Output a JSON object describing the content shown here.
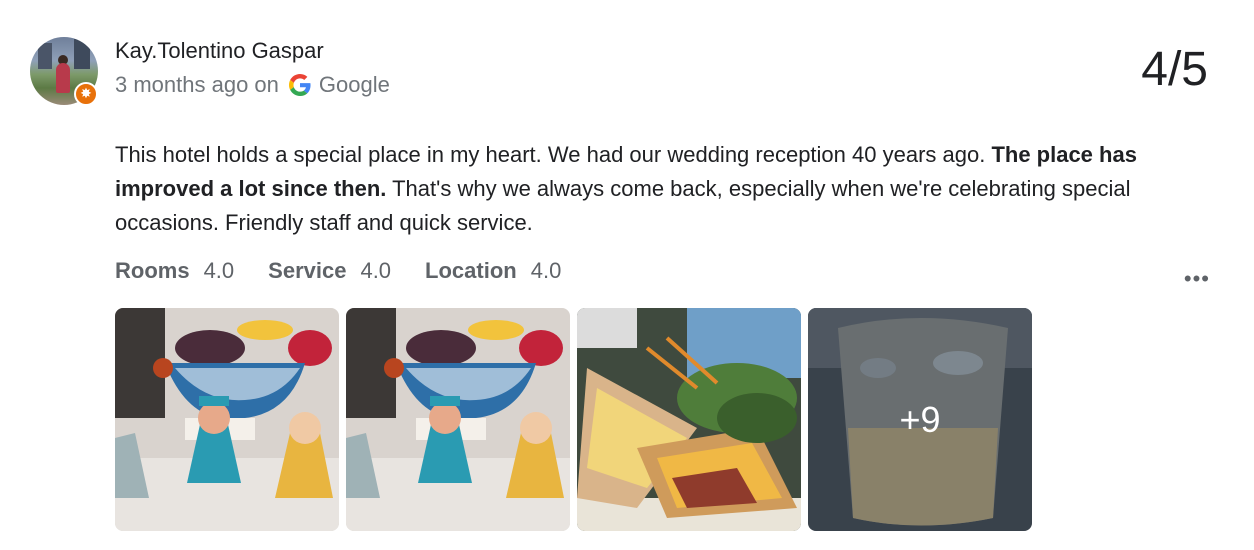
{
  "review": {
    "author": "Kay.Tolentino Gaspar",
    "time": "3 months ago on",
    "source": "Google",
    "rating": "4/5",
    "badge_icon": "local-guide-star-icon",
    "text_part1": "This hotel holds a special place in my heart. We had our wedding reception 40 years ago. ",
    "text_bold": "The place has improved a lot since then.",
    "text_part2": " That's why we always come back, especially when we're celebrating special occasions. Friendly staff and quick service.",
    "subratings": [
      {
        "category": "Rooms",
        "value": "4.0"
      },
      {
        "category": "Service",
        "value": "4.0"
      },
      {
        "category": "Location",
        "value": "4.0"
      }
    ],
    "more_icon": "more-horizontal-icon",
    "photos": [
      {
        "description": "ceramic-figurines-fruit-bowl"
      },
      {
        "description": "ceramic-figurines-fruit-bowl"
      },
      {
        "description": "club-sandwich-salad"
      },
      {
        "description": "iced-drink-glass"
      }
    ],
    "more_photos": "+9"
  }
}
